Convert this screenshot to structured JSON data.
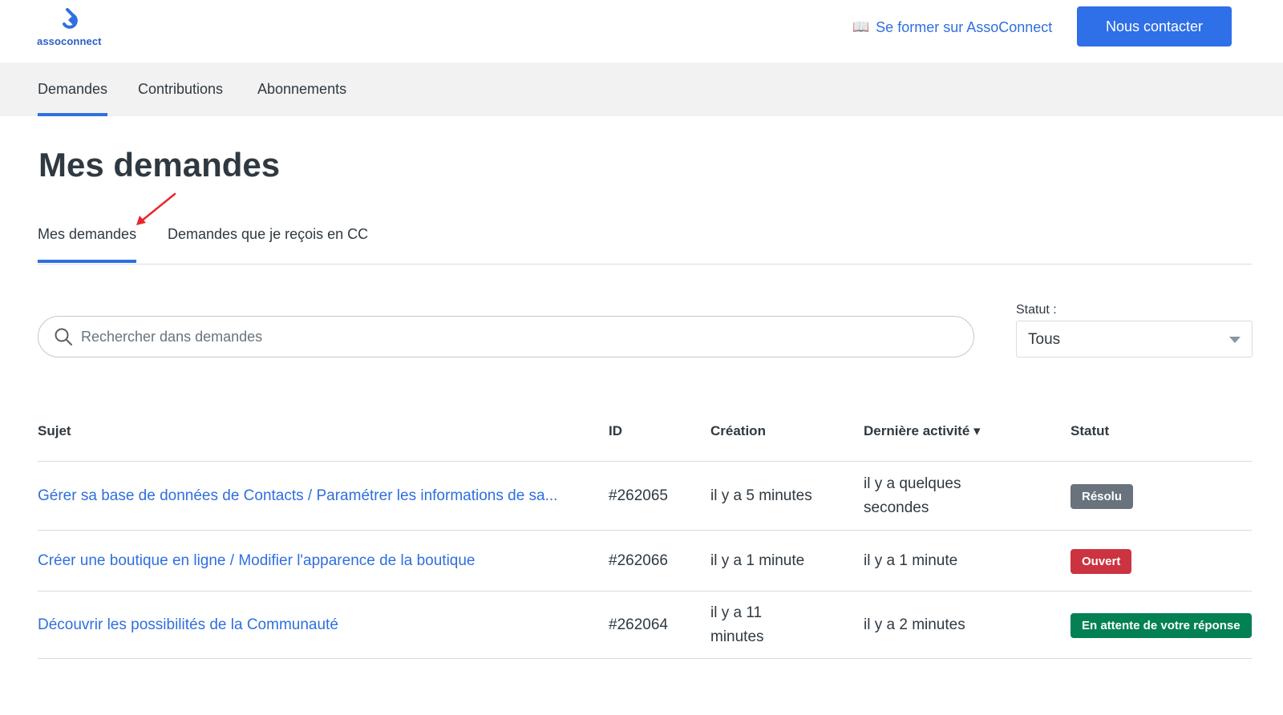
{
  "header": {
    "logo_text": "assoconnect",
    "learn_link": "Se former sur AssoConnect",
    "contact_button": "Nous contacter"
  },
  "nav": {
    "items": [
      {
        "label": "Demandes",
        "active": true
      },
      {
        "label": "Contributions",
        "active": false
      },
      {
        "label": "Abonnements",
        "active": false
      }
    ]
  },
  "page": {
    "title": "Mes demandes",
    "tabs": [
      {
        "label": "Mes demandes",
        "active": true
      },
      {
        "label": "Demandes que je reçois en CC",
        "active": false
      }
    ]
  },
  "search": {
    "placeholder": "Rechercher dans demandes"
  },
  "filter": {
    "label": "Statut :",
    "value": "Tous"
  },
  "table": {
    "headers": [
      "Sujet",
      "ID",
      "Création",
      "Dernière activité ▾",
      "Statut"
    ],
    "rows": [
      {
        "subject": "Gérer sa base de données de Contacts / Paramétrer les informations de sa...",
        "id": "#262065",
        "created": "il y a 5 minutes",
        "last_activity_1": "il y a quelques",
        "last_activity_2": "secondes",
        "status": "Résolu",
        "status_color": "#68737d"
      },
      {
        "subject": "Créer une boutique en ligne / Modifier l'apparence de la boutique",
        "id": "#262066",
        "created": "il y a 1 minute",
        "last_activity": "il y a 1 minute",
        "status": "Ouvert",
        "status_color": "#cc3340"
      },
      {
        "subject": "Découvrir les possibilités de la Communauté",
        "id": "#262064",
        "created_1": "il y a 11",
        "created_2": "minutes",
        "last_activity": "il y a 2 minutes",
        "status": "En attente de votre réponse",
        "status_color": "#038153"
      }
    ]
  },
  "colors": {
    "accent": "#2f6fe0",
    "annotation_arrow": "#e8262a"
  }
}
